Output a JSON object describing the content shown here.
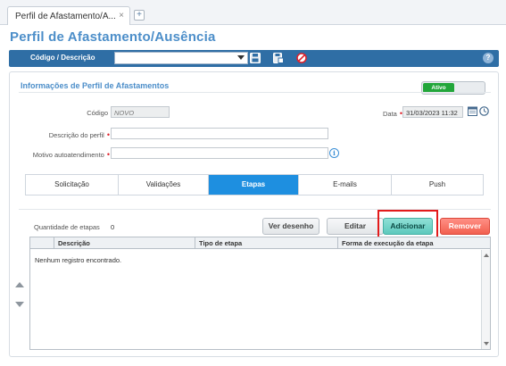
{
  "tabs": [
    {
      "label": "Perfil de Afastamento/A...",
      "close": "×"
    }
  ],
  "tab_add": "+",
  "page_title": "Perfil de Afastamento/Ausência",
  "toolbar": {
    "code_description_label": "Código / Descrição",
    "code_description_value": "",
    "icons": [
      "save-icon",
      "save-as-icon",
      "cancel-icon"
    ],
    "help": "?"
  },
  "section": {
    "title": "Informações de Perfil de Afastamentos",
    "status_toggle": "Ativo"
  },
  "form": {
    "codigo_label": "Código",
    "codigo_value": "NOVO",
    "data_label": "Data",
    "data_value": "31/03/2023 11:32",
    "descricao_label": "Descrição do perfil",
    "descricao_value": "",
    "motivo_label": "Motivo autoatendimento",
    "motivo_value": "",
    "required_mark": "•",
    "info_icon": "i"
  },
  "step_tabs": [
    {
      "label": "Solicitação",
      "active": false
    },
    {
      "label": "Validações",
      "active": false
    },
    {
      "label": "Etapas",
      "active": true
    },
    {
      "label": "E-mails",
      "active": false
    },
    {
      "label": "Push",
      "active": false
    }
  ],
  "steps_panel": {
    "quantity_label": "Quantidade de etapas",
    "quantity_value": "0",
    "buttons": {
      "ver_desenho": "Ver desenho",
      "editar": "Editar",
      "adicionar": "Adicionar",
      "remover": "Remover"
    },
    "grid": {
      "columns": [
        "Descrição",
        "Tipo de etapa",
        "Forma de execução da etapa"
      ],
      "empty_message": "Nenhum registro encontrado."
    }
  },
  "colors": {
    "title_blue": "#4c8ec9",
    "toolbar_blue": "#2f6ea5",
    "active_tab": "#1e8fe0",
    "active_toggle": "#22a63a",
    "add_button": "#5cc9bd",
    "remove_button": "#f2604f",
    "highlight": "#e31b1b"
  }
}
